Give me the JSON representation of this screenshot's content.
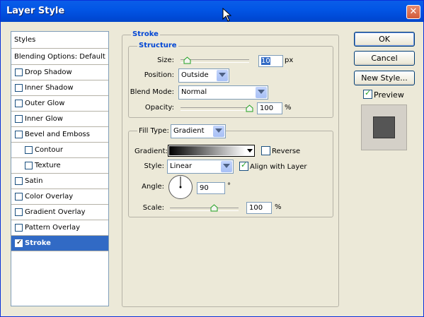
{
  "window": {
    "title": "Layer Style",
    "close_label": "✕"
  },
  "left_panel": {
    "items": [
      {
        "label": "Styles",
        "checkbox": false
      },
      {
        "label": "Blending Options: Default",
        "checkbox": false
      },
      {
        "label": "Drop Shadow",
        "checkbox": true,
        "checked": false
      },
      {
        "label": "Inner Shadow",
        "checkbox": true,
        "checked": false
      },
      {
        "label": "Outer Glow",
        "checkbox": true,
        "checked": false
      },
      {
        "label": "Inner Glow",
        "checkbox": true,
        "checked": false
      },
      {
        "label": "Bevel and Emboss",
        "checkbox": true,
        "checked": false
      },
      {
        "label": "Contour",
        "checkbox": true,
        "checked": false,
        "indent": true
      },
      {
        "label": "Texture",
        "checkbox": true,
        "checked": false,
        "indent": true
      },
      {
        "label": "Satin",
        "checkbox": true,
        "checked": false
      },
      {
        "label": "Color Overlay",
        "checkbox": true,
        "checked": false
      },
      {
        "label": "Gradient Overlay",
        "checkbox": true,
        "checked": false
      },
      {
        "label": "Pattern Overlay",
        "checkbox": true,
        "checked": false
      },
      {
        "label": "Stroke",
        "checkbox": true,
        "checked": true,
        "selected": true
      }
    ]
  },
  "stroke": {
    "title": "Stroke",
    "structure": {
      "title": "Structure",
      "size_label": "Size:",
      "size_value": "10",
      "size_unit": "px",
      "position_label": "Position:",
      "position_value": "Outside",
      "blend_label": "Blend Mode:",
      "blend_value": "Normal",
      "opacity_label": "Opacity:",
      "opacity_value": "100",
      "opacity_unit": "%"
    },
    "fill": {
      "fill_type_label": "Fill Type:",
      "fill_type_value": "Gradient",
      "gradient_label": "Gradient:",
      "reverse_label": "Reverse",
      "style_label": "Style:",
      "style_value": "Linear",
      "align_label": "Align with Layer",
      "angle_label": "Angle:",
      "angle_value": "90",
      "angle_unit": "°",
      "scale_label": "Scale:",
      "scale_value": "100",
      "scale_unit": "%"
    }
  },
  "buttons": {
    "ok": "OK",
    "cancel": "Cancel",
    "new_style": "New Style...",
    "preview": "Preview"
  },
  "colors": {
    "title_bar": "#0054e3",
    "selection": "#316ac5",
    "group_title": "#0046d5",
    "preview_swatch": "#555555"
  }
}
